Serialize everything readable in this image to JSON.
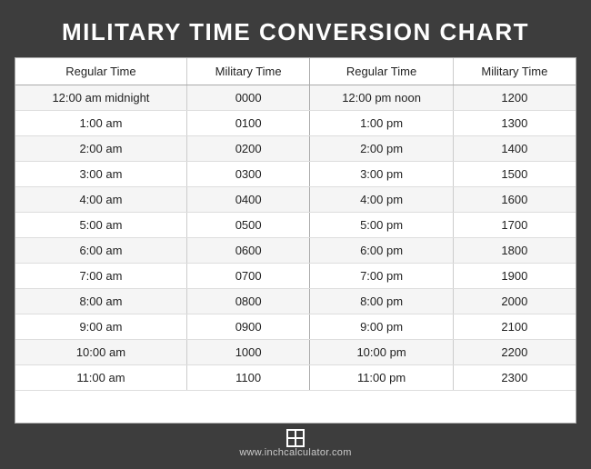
{
  "title": "MILITARY TIME CONVERSION CHART",
  "table": {
    "headers": [
      "Regular Time",
      "Military Time",
      "Regular Time",
      "Military Time"
    ],
    "rows": [
      [
        "12:00 am midnight",
        "0000",
        "12:00 pm noon",
        "1200"
      ],
      [
        "1:00 am",
        "0100",
        "1:00 pm",
        "1300"
      ],
      [
        "2:00 am",
        "0200",
        "2:00 pm",
        "1400"
      ],
      [
        "3:00 am",
        "0300",
        "3:00 pm",
        "1500"
      ],
      [
        "4:00 am",
        "0400",
        "4:00 pm",
        "1600"
      ],
      [
        "5:00 am",
        "0500",
        "5:00 pm",
        "1700"
      ],
      [
        "6:00 am",
        "0600",
        "6:00 pm",
        "1800"
      ],
      [
        "7:00 am",
        "0700",
        "7:00 pm",
        "1900"
      ],
      [
        "8:00 am",
        "0800",
        "8:00 pm",
        "2000"
      ],
      [
        "9:00 am",
        "0900",
        "9:00 pm",
        "2100"
      ],
      [
        "10:00 am",
        "1000",
        "10:00 pm",
        "2200"
      ],
      [
        "11:00 am",
        "1100",
        "11:00 pm",
        "2300"
      ]
    ]
  },
  "footer": {
    "url": "www.inchcalculator.com"
  }
}
